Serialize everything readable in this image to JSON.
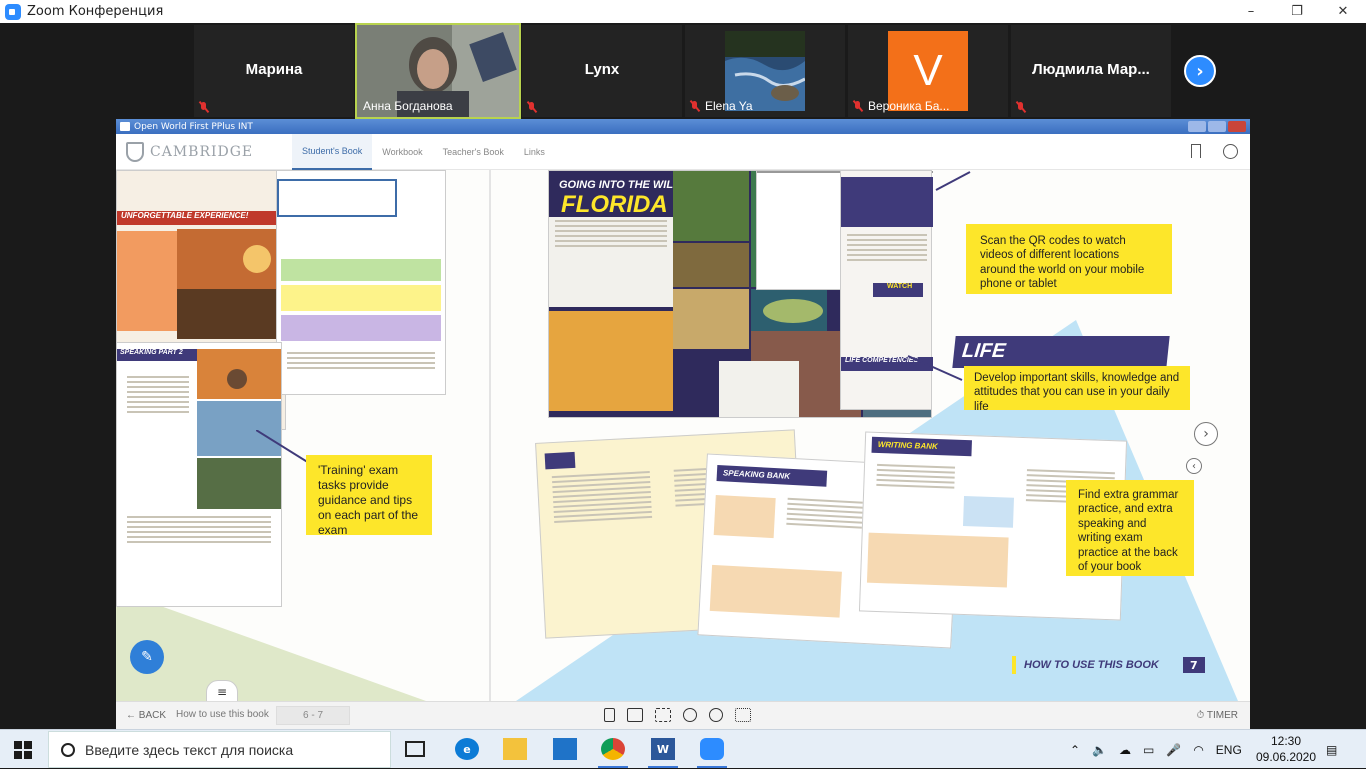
{
  "window": {
    "title": "Zoom Конференция",
    "min": "–",
    "max": "❐",
    "close": "✕"
  },
  "participants": [
    {
      "name": "Марина",
      "label": ""
    },
    {
      "name": "",
      "label": "Анна Богданова"
    },
    {
      "name": "Lynx",
      "label": ""
    },
    {
      "name": "",
      "label": "Elena Ya"
    },
    {
      "name": "",
      "label": "Вероника Ба...",
      "avatar": "V"
    },
    {
      "name": "Людмила  Мар...",
      "label": ""
    }
  ],
  "gallery": {
    "next_icon": "chevron-right-icon"
  },
  "share": {
    "title": "Open World First PPlus INT",
    "brand": "CAMBRIDGE",
    "tabs": [
      "Student's Book",
      "Workbook",
      "Teacher's Book",
      "Links"
    ],
    "active_tab": "Student's Book"
  },
  "book": {
    "heading_wild": "GOING INTO THE WILD IN ...",
    "heading_florida": "FLORIDA",
    "unforgettable": "UNFORGETTABLE EXPERIENCE!",
    "speaking_part": "SPEAKING PART 2",
    "life_competencies": "LIFE COMPETENCIES",
    "life_comp_small": "LIFE COMPETENCIES",
    "writing_bank": "WRITING BANK",
    "speaking_bank": "SPEAKING BANK",
    "watch": "WATCH",
    "footer": "HOW TO USE THIS BOOK",
    "page_num": "7",
    "callouts": {
      "qr": "Scan the QR codes to watch videos of different locations around the world on your mobile phone or tablet",
      "life": "Develop important skills, knowledge and attitudes that you can use in your daily life",
      "training": "'Training' exam tasks provide guidance and tips on each part of the exam",
      "extra": "Find extra grammar practice, and extra speaking and writing exam practice at the back of your book"
    }
  },
  "bottombar": {
    "back": "BACK",
    "crumb": "How to use this book",
    "pages": "6 - 7",
    "timer": "TIMER"
  },
  "taskbar": {
    "search_placeholder": "Введите здесь текст для поиска",
    "lang": "ENG",
    "time": "12:30",
    "date": "09.06.2020"
  },
  "colors": {
    "zoom_blue": "#2d8cff",
    "book_yellow": "#fde62a",
    "book_purple": "#3f3a7a",
    "active_outline": "#b8d34e"
  }
}
